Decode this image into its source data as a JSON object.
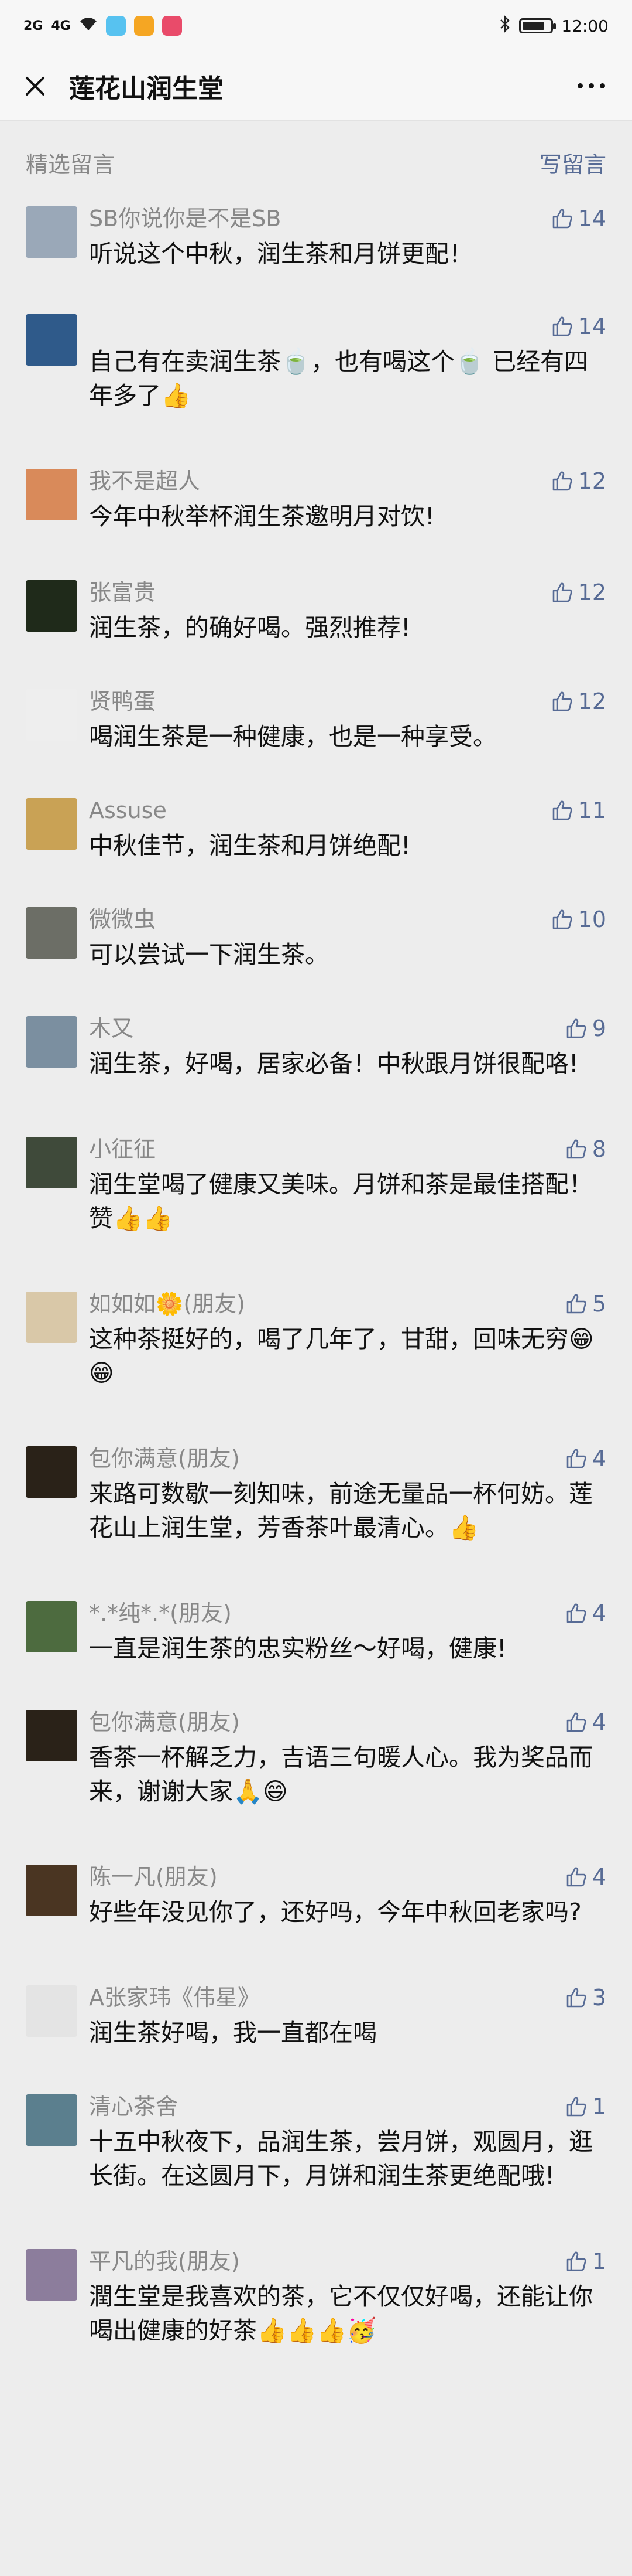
{
  "status": {
    "signal1": "2G",
    "signal2": "4G",
    "time": "12:00",
    "battery_level": 0.8
  },
  "nav": {
    "title": "莲花山润生堂",
    "close_icon": "close-icon",
    "more_icon": "more-icon"
  },
  "section": {
    "title": "精选留言",
    "write_label": "写留言"
  },
  "comments": [
    {
      "author": "SB你说你是不是SB",
      "text": "听说这个中秋，润生茶和月饼更配！",
      "likes": "14",
      "avatar_color": "#9aa8b8"
    },
    {
      "author": "",
      "text": "自己有在卖润生茶🍵，也有喝这个🍵 已经有四年多了👍",
      "likes": "14",
      "avatar_color": "#2f5a8a"
    },
    {
      "author": "我不是超人",
      "text": "今年中秋举杯润生茶邀明月对饮!",
      "likes": "12",
      "avatar_color": "#d98a5a"
    },
    {
      "author": "张富贵",
      "text": "润生茶，的确好喝。强烈推荐!",
      "likes": "12",
      "avatar_color": "#1f2a1a"
    },
    {
      "author": "贤鸭蛋",
      "text": "喝润生茶是一种健康，也是一种享受。",
      "likes": "12",
      "avatar_color": "#eeeeee"
    },
    {
      "author": "Assuse",
      "text": "中秋佳节，润生茶和月饼绝配!",
      "likes": "11",
      "avatar_color": "#c9a255"
    },
    {
      "author": "微微虫",
      "text": "可以尝试一下润生茶。",
      "likes": "10",
      "avatar_color": "#6c6e66"
    },
    {
      "author": "木又",
      "text": "润生茶，好喝，居家必备！中秋跟月饼很配咯!",
      "likes": "9",
      "avatar_color": "#7b8fa0"
    },
    {
      "author": "小征征",
      "text": "润生堂喝了健康又美味。月饼和茶是最佳搭配！赞👍👍",
      "likes": "8",
      "avatar_color": "#3f4a3a"
    },
    {
      "author": "如如如🌼(朋友)",
      "text": "这种茶挺好的，喝了几年了，甘甜，回味无穷😁😁",
      "likes": "5",
      "avatar_color": "#d9c8a8"
    },
    {
      "author": "包你满意(朋友)",
      "text": "来路可数歇一刻知味，前途无量品一杯何妨。莲花山上润生堂，芳香茶叶最清心。👍",
      "likes": "4",
      "avatar_color": "#2a2218"
    },
    {
      "author": "*.*纯*.*(朋友)",
      "text": "一直是润生茶的忠实粉丝～好喝，健康!",
      "likes": "4",
      "avatar_color": "#4d6b3f"
    },
    {
      "author": "包你满意(朋友)",
      "text": "香茶一杯解乏力，吉语三句暖人心。我为奖品而来，谢谢大家🙏😄",
      "likes": "4",
      "avatar_color": "#2a2218"
    },
    {
      "author": "陈一凡(朋友)",
      "text": "好些年没见你了，还好吗，今年中秋回老家吗?",
      "likes": "4",
      "avatar_color": "#4a3522"
    },
    {
      "author": "A张家玮《伟星》",
      "text": "润生茶好喝，我一直都在喝",
      "likes": "3",
      "avatar_color": "#e4e4e4"
    },
    {
      "author": "清心茶舍",
      "text": "十五中秋夜下，品润生茶，尝月饼，观圆月，逛长街。在这圆月下，月饼和润生茶更绝配哦!",
      "likes": "1",
      "avatar_color": "#5b7f8e"
    },
    {
      "author": "平凡的我(朋友)",
      "text": "潤生堂是我喜欢的茶，它不仅仅好喝，还能让你喝出健康的好茶👍👍👍🥳",
      "likes": "1",
      "avatar_color": "#8c7d9c"
    }
  ]
}
